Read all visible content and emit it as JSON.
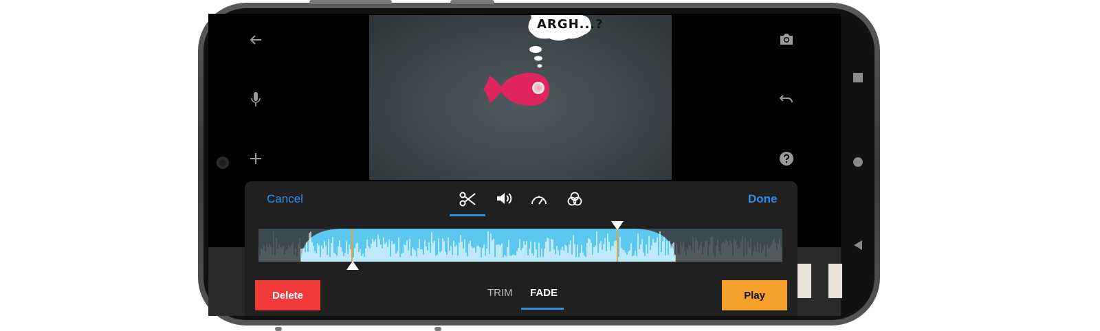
{
  "preview": {
    "speech_text": "ARGH...?"
  },
  "toolbar": {
    "cancel_label": "Cancel",
    "done_label": "Done",
    "tools": [
      "scissors-icon",
      "volume-icon",
      "speed-icon",
      "filter-icon"
    ],
    "active_tool": "scissors-icon"
  },
  "modes": {
    "trim_label": "TRIM",
    "fade_label": "FADE",
    "active": "FADE"
  },
  "actions": {
    "delete_label": "Delete",
    "play_label": "Play"
  },
  "side_icons": {
    "left": [
      "back-arrow-icon",
      "microphone-icon",
      "add-icon"
    ],
    "right": [
      "camera-icon",
      "undo-icon",
      "help-icon"
    ]
  },
  "colors": {
    "accent": "#2f8ee6",
    "delete": "#f03a3a",
    "play": "#f5a02a",
    "waveform_selected": "#5cc8f0",
    "marker": "#e8a23a"
  }
}
